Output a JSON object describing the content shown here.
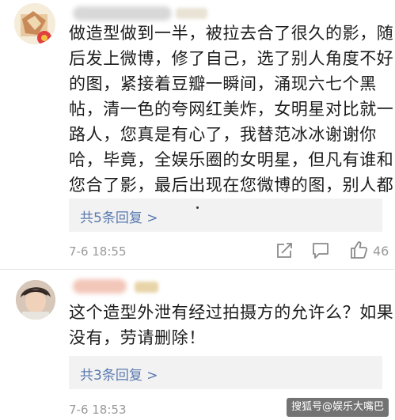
{
  "comments": [
    {
      "text_lines": [
        "做造型做到一半，被拉去合了很久的影，随",
        "后发上微博，修了自己，选了别人角度不好",
        "的图，紧接着豆瓣一瞬间，涌现六七个黑",
        "帖，清一色的夸网红美炸，女明星对比就一",
        "路人，您真是有心了，我替范冰冰谢谢你",
        "哈，毕竟，全娱乐圈的女明星，但凡有谁和",
        "您合了影，最后出现在您微博的图，别人都…"
      ],
      "reply_link": "共5条回复 >",
      "timestamp": "7-6 18:55",
      "like_count": "46"
    },
    {
      "text_lines": [
        "这个造型外泄有经过拍摄方的允许么？如果",
        "没有，劳请删除！"
      ],
      "reply_link": "共3条回复 >",
      "timestamp": "7-6 18:53"
    }
  ],
  "watermark": "搜狐号@娱乐大嘴巴",
  "colors": {
    "link": "#5a7ab0",
    "meta": "#9a9a9a",
    "reply_bg": "#f2f2f2",
    "text": "#1c1c1c"
  },
  "icons": {
    "share": "share-icon",
    "comment": "comment-icon",
    "like": "thumbs-up-icon"
  }
}
